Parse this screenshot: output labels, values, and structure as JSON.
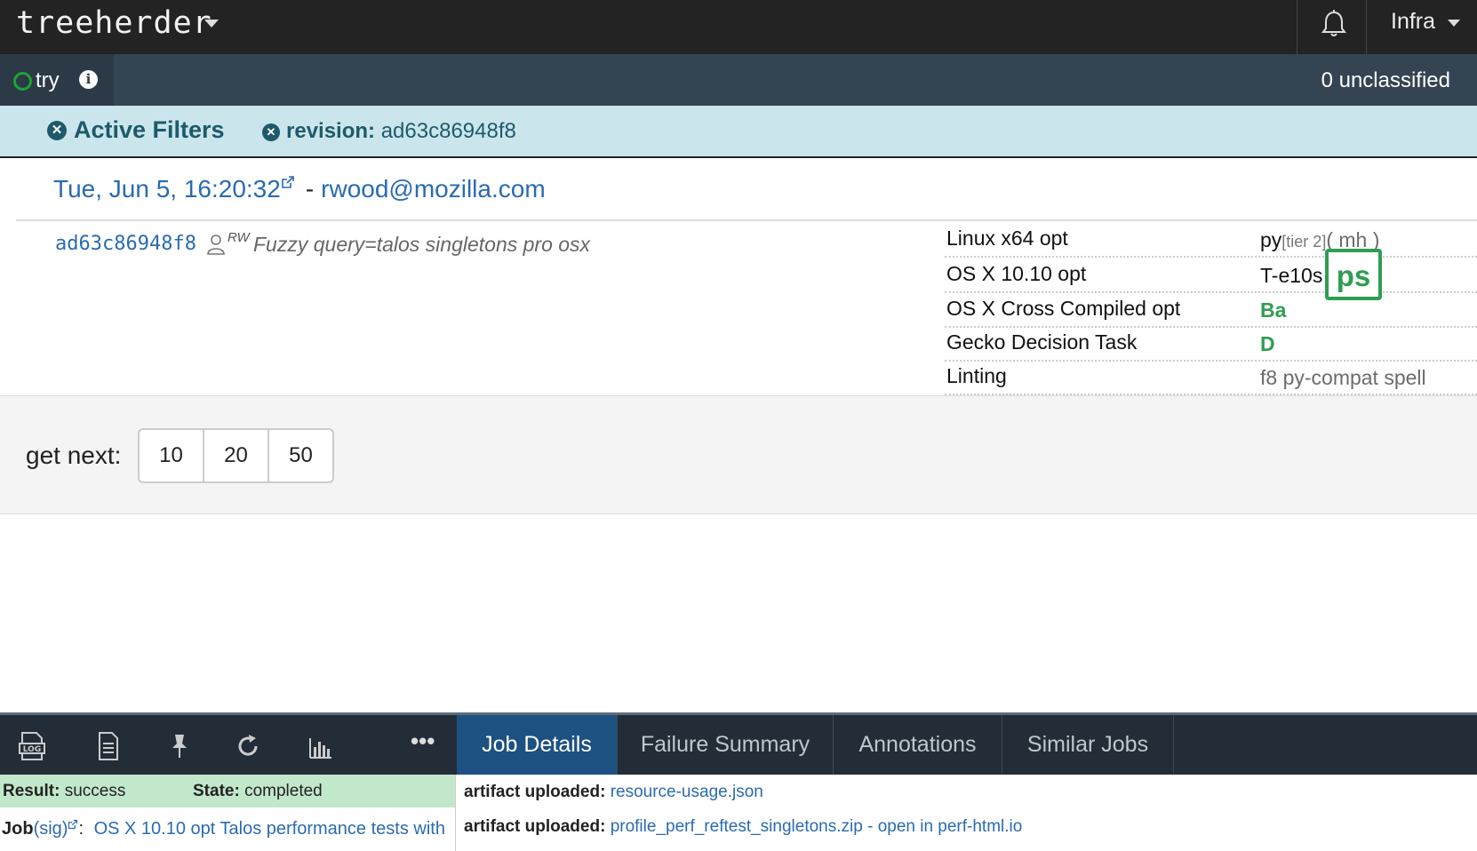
{
  "topnav": {
    "logo": "treeherder",
    "bell_icon": "bell-icon",
    "user_menu": "Infra"
  },
  "secnav": {
    "repo": "try",
    "info_icon": "info-icon",
    "unclassified": "0 unclassified"
  },
  "filters": {
    "active_label": "Active Filters",
    "revision_key": "revision:",
    "revision_value": "ad63c86948f8"
  },
  "push": {
    "date": "Tue, Jun 5, 16:20:32",
    "separator": "-",
    "author": "rwood@mozilla.com",
    "revision": "ad63c86948f8",
    "rw_badge": "RW",
    "commit_message": "Fuzzy query=talos singletons pro osx",
    "platforms": [
      {
        "name": "Linux x64 opt",
        "jobs_a": "py",
        "tier": "[tier 2]",
        "jobs_b": "( mh )"
      },
      {
        "name": "OS X 10.10 opt",
        "jobs_a": "T-e10s",
        "selected_job": "ps"
      },
      {
        "name": "OS X Cross Compiled opt",
        "jobs_a": "Ba"
      },
      {
        "name": "Gecko Decision Task",
        "jobs_a": "D"
      },
      {
        "name": "Linting",
        "jobs_a": "f8 py-compat spell"
      }
    ]
  },
  "get_next": {
    "label": "get next:",
    "options": [
      "10",
      "20",
      "50"
    ]
  },
  "bottom_panel": {
    "tabs": [
      "Job Details",
      "Failure Summary",
      "Annotations",
      "Similar Jobs"
    ],
    "active_tab": "Job Details",
    "ellipsis": "•••",
    "result_label": "Result:",
    "result_value": "success",
    "state_label": "State:",
    "state_value": "completed",
    "job_label": "Job",
    "job_sig": "(sig)",
    "job_name": "OS X 10.10 opt Talos performance tests with",
    "artifacts": [
      {
        "label": "artifact uploaded:",
        "link": "resource-usage.json"
      },
      {
        "label": "artifact uploaded:",
        "link": "profile_perf_reftest_singletons.zip",
        "extra_sep": " - ",
        "extra_link": "open in perf-html.io"
      }
    ]
  },
  "colors": {
    "nav_bg": "#232323",
    "secnav_bg": "#354452",
    "filter_bg": "#cbe5ec",
    "success_green": "#2e9e52",
    "link_blue": "#2a6bb1",
    "active_tab_bg": "#1d5181"
  }
}
